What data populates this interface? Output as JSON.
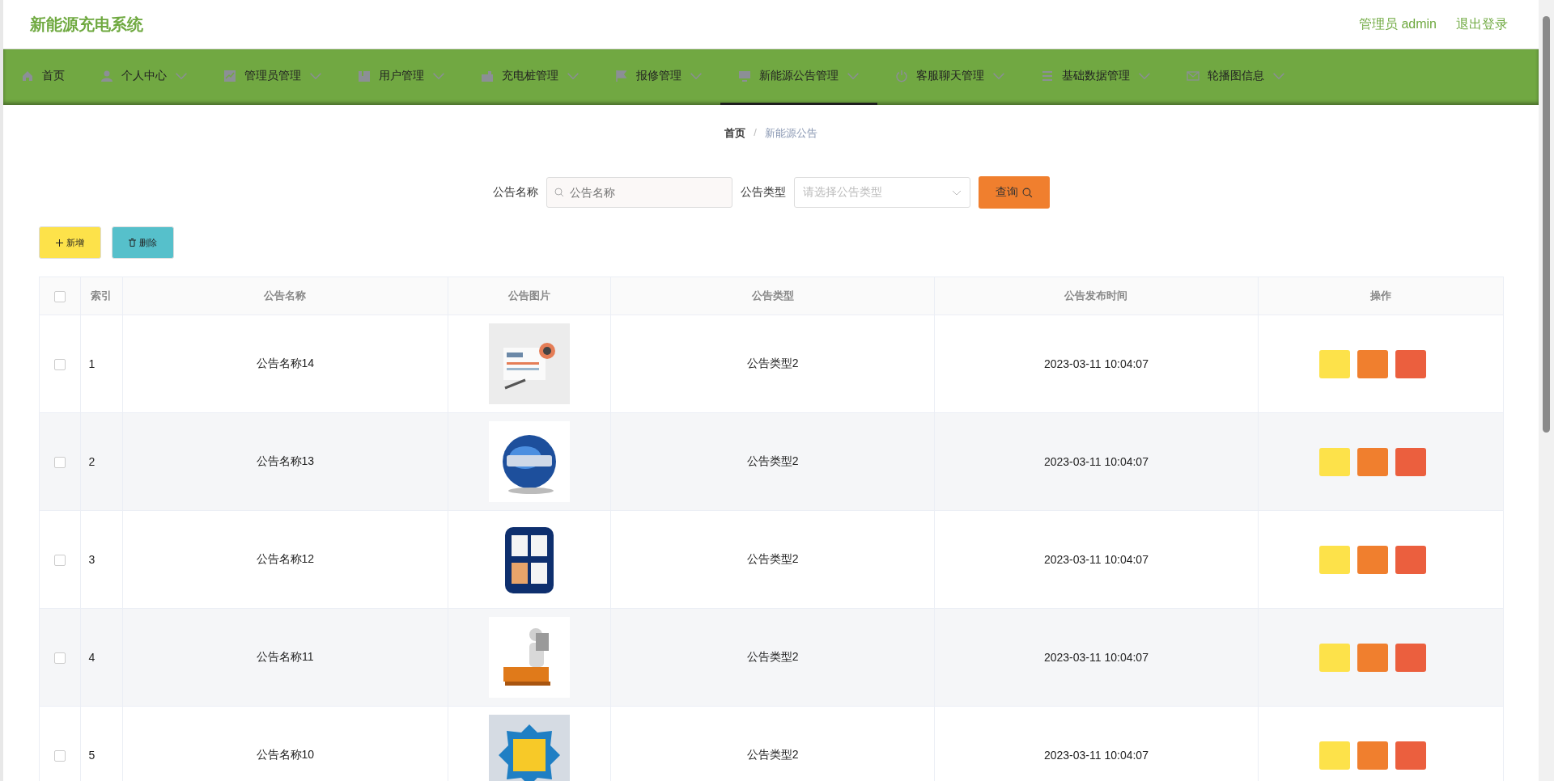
{
  "header": {
    "title": "新能源充电系统",
    "user": "管理员 admin",
    "logout": "退出登录"
  },
  "nav": [
    {
      "label": "首页",
      "selected": false,
      "dropdown": false
    },
    {
      "label": "个人中心",
      "selected": false,
      "dropdown": true
    },
    {
      "label": "管理员管理",
      "selected": false,
      "dropdown": true
    },
    {
      "label": "用户管理",
      "selected": false,
      "dropdown": true
    },
    {
      "label": "充电桩管理",
      "selected": false,
      "dropdown": true
    },
    {
      "label": "报修管理",
      "selected": false,
      "dropdown": true
    },
    {
      "label": "新能源公告管理",
      "selected": true,
      "dropdown": true
    },
    {
      "label": "客服聊天管理",
      "selected": false,
      "dropdown": true
    },
    {
      "label": "基础数据管理",
      "selected": false,
      "dropdown": true
    },
    {
      "label": "轮播图信息",
      "selected": false,
      "dropdown": true
    }
  ],
  "breadcrumb": [
    "首页",
    "新能源公告"
  ],
  "breadcrumb_separator": "/",
  "search": {
    "name_label": "公告名称",
    "name_placeholder": "公告名称",
    "type_label": "公告类型",
    "type_placeholder": "请选择公告类型",
    "query_button": "查询"
  },
  "actions": {
    "add": "新增",
    "delete": "删除"
  },
  "table": {
    "all_checked": false,
    "columns": [
      "索引",
      "公告名称",
      "公告图片",
      "公告类型",
      "公告发布时间",
      "操作"
    ],
    "rows": [
      {
        "checked": false,
        "index": "1",
        "name": "公告名称14",
        "type": "公告类型2",
        "time": "2023-03-11 10:04:07"
      },
      {
        "checked": false,
        "index": "2",
        "name": "公告名称13",
        "type": "公告类型2",
        "time": "2023-03-11 10:04:07"
      },
      {
        "checked": false,
        "index": "3",
        "name": "公告名称12",
        "type": "公告类型2",
        "time": "2023-03-11 10:04:07"
      },
      {
        "checked": false,
        "index": "4",
        "name": "公告名称11",
        "type": "公告类型2",
        "time": "2023-03-11 10:04:07"
      },
      {
        "checked": false,
        "index": "5",
        "name": "公告名称10",
        "type": "公告类型2",
        "time": "2023-03-11 10:04:07"
      }
    ]
  }
}
